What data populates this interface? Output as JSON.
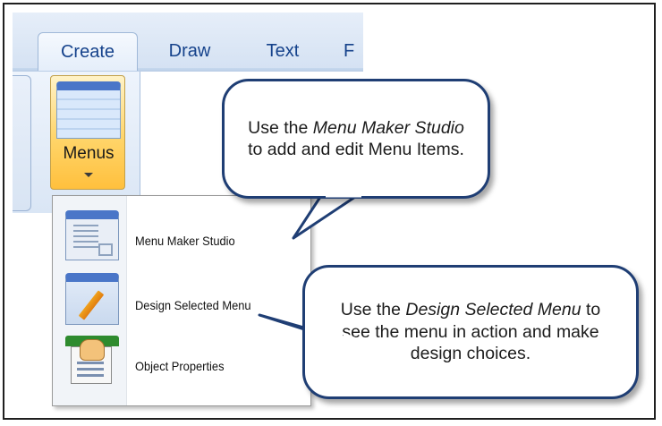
{
  "ribbon": {
    "tabs": [
      {
        "label": "Create",
        "active": true
      },
      {
        "label": "Draw",
        "active": false
      },
      {
        "label": "Text",
        "active": false
      },
      {
        "label": "F",
        "active": false
      }
    ],
    "menus_button": {
      "label": "Menus"
    }
  },
  "dropdown": {
    "items": [
      {
        "label": "Menu Maker Studio",
        "icon": "menu-maker-studio-icon"
      },
      {
        "label": "Design Selected Menu",
        "icon": "design-pencil-icon"
      },
      {
        "label": "Object Properties",
        "icon": "object-properties-icon"
      }
    ]
  },
  "callouts": {
    "first": {
      "pre": "Use the ",
      "emph": "Menu Maker Studio",
      "post": " to add and edit Menu Items."
    },
    "second": {
      "pre": "Use the ",
      "emph": "Design Selected Menu",
      "post": " to see the menu in action and make design choices."
    }
  },
  "colors": {
    "callout_border": "#1f3e74",
    "ribbon_text": "#15428b",
    "menus_button": "#ffd56a"
  }
}
